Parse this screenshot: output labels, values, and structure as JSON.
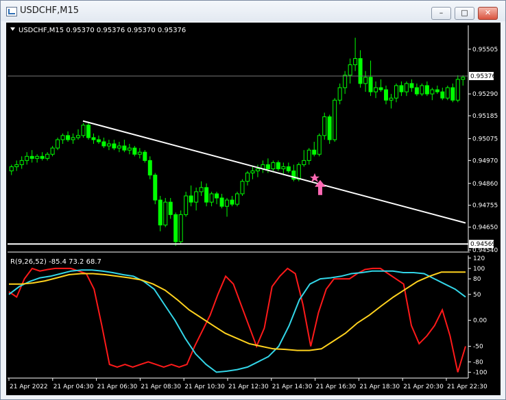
{
  "window": {
    "title": "USDCHF,M15",
    "buttons": {
      "minimize": "–",
      "maximize": "□",
      "close": "✕"
    }
  },
  "main_chart": {
    "header": "USDCHF,M15  0.95370 0.95376 0.95370 0.95376",
    "price_labels": [
      "0.95505",
      "0.95290",
      "0.95185",
      "0.95075",
      "0.94970",
      "0.94860",
      "0.94755",
      "0.94650",
      "0.94540"
    ],
    "current_price_label": "0.95376",
    "hline_price_label": "0.94569"
  },
  "indicator": {
    "header": "R(9,26,52) -85.4 73.2 68.7",
    "scale_labels": [
      "120",
      "100",
      "80",
      "50",
      "0.00",
      "-50",
      "-80",
      "-100"
    ]
  },
  "time_labels": [
    "21 Apr 2022",
    "21 Apr 04:30",
    "21 Apr 06:30",
    "21 Apr 08:30",
    "21 Apr 10:30",
    "21 Apr 12:30",
    "21 Apr 14:30",
    "21 Apr 16:30",
    "21 Apr 18:30",
    "21 Apr 20:30",
    "21 Apr 22:30"
  ],
  "colors": {
    "background": "#000000",
    "candles": "#00ff00",
    "trendline": "#ffffff",
    "arrow": "#ff69b4",
    "series_red": "#ff1a1a",
    "series_cyan": "#33d6e8",
    "series_yellow": "#ffd21e"
  },
  "chart_data": [
    {
      "type": "candlestick",
      "title": "USDCHF,M15",
      "ylim": [
        0.9454,
        0.9558
      ],
      "ohlc": [
        [
          0.9492,
          0.9495,
          0.949,
          0.9494
        ],
        [
          0.9494,
          0.9497,
          0.9492,
          0.9495
        ],
        [
          0.9495,
          0.9499,
          0.9493,
          0.9497
        ],
        [
          0.9497,
          0.9501,
          0.9495,
          0.9499
        ],
        [
          0.9499,
          0.9502,
          0.9496,
          0.9498
        ],
        [
          0.9498,
          0.95,
          0.9496,
          0.9499
        ],
        [
          0.9499,
          0.9501,
          0.9497,
          0.9498
        ],
        [
          0.9498,
          0.9501,
          0.9497,
          0.95
        ],
        [
          0.95,
          0.9504,
          0.9499,
          0.9503
        ],
        [
          0.9503,
          0.9508,
          0.9502,
          0.9507
        ],
        [
          0.9507,
          0.951,
          0.9505,
          0.9509
        ],
        [
          0.9509,
          0.9511,
          0.9506,
          0.9507
        ],
        [
          0.9507,
          0.951,
          0.9505,
          0.9508
        ],
        [
          0.9508,
          0.9512,
          0.9507,
          0.9509
        ],
        [
          0.9509,
          0.9515,
          0.9508,
          0.9514
        ],
        [
          0.9514,
          0.9515,
          0.9507,
          0.9508
        ],
        [
          0.9508,
          0.951,
          0.9505,
          0.9507
        ],
        [
          0.9507,
          0.9509,
          0.9505,
          0.9506
        ],
        [
          0.9506,
          0.9508,
          0.9503,
          0.9504
        ],
        [
          0.9504,
          0.9507,
          0.9502,
          0.9505
        ],
        [
          0.9505,
          0.9507,
          0.9502,
          0.9503
        ],
        [
          0.9503,
          0.9506,
          0.9501,
          0.9504
        ],
        [
          0.9504,
          0.9507,
          0.9501,
          0.9502
        ],
        [
          0.9502,
          0.9505,
          0.95,
          0.9503
        ],
        [
          0.9503,
          0.9504,
          0.9499,
          0.95
        ],
        [
          0.95,
          0.9503,
          0.9498,
          0.9501
        ],
        [
          0.9501,
          0.9502,
          0.9496,
          0.9497
        ],
        [
          0.9497,
          0.9499,
          0.9488,
          0.949
        ],
        [
          0.949,
          0.9491,
          0.9476,
          0.9478
        ],
        [
          0.9478,
          0.948,
          0.9463,
          0.9466
        ],
        [
          0.9466,
          0.9479,
          0.9465,
          0.9477
        ],
        [
          0.9477,
          0.9479,
          0.9469,
          0.9471
        ],
        [
          0.9471,
          0.9472,
          0.9456,
          0.9458
        ],
        [
          0.9458,
          0.9473,
          0.9457,
          0.9471
        ],
        [
          0.9471,
          0.9482,
          0.947,
          0.948
        ],
        [
          0.948,
          0.9485,
          0.9475,
          0.9477
        ],
        [
          0.9477,
          0.9484,
          0.9473,
          0.9482
        ],
        [
          0.9482,
          0.9487,
          0.948,
          0.9484
        ],
        [
          0.9484,
          0.9486,
          0.9475,
          0.9477
        ],
        [
          0.9477,
          0.9482,
          0.9475,
          0.9481
        ],
        [
          0.9481,
          0.9482,
          0.9476,
          0.9479
        ],
        [
          0.9479,
          0.9481,
          0.9474,
          0.9475
        ],
        [
          0.9475,
          0.9479,
          0.947,
          0.9478
        ],
        [
          0.9478,
          0.948,
          0.9475,
          0.9476
        ],
        [
          0.9476,
          0.9482,
          0.9475,
          0.9481
        ],
        [
          0.9481,
          0.9488,
          0.948,
          0.9487
        ],
        [
          0.9487,
          0.9492,
          0.9485,
          0.9491
        ],
        [
          0.9491,
          0.9494,
          0.9488,
          0.9492
        ],
        [
          0.9492,
          0.9495,
          0.9489,
          0.9493
        ],
        [
          0.9493,
          0.9497,
          0.9491,
          0.9495
        ],
        [
          0.9495,
          0.9498,
          0.9491,
          0.9493
        ],
        [
          0.9493,
          0.9497,
          0.9492,
          0.9496
        ],
        [
          0.9496,
          0.9497,
          0.9492,
          0.9493
        ],
        [
          0.9493,
          0.9496,
          0.949,
          0.9494
        ],
        [
          0.9494,
          0.9496,
          0.9491,
          0.9492
        ],
        [
          0.9492,
          0.9495,
          0.9487,
          0.9488
        ],
        [
          0.9488,
          0.9496,
          0.9487,
          0.9495
        ],
        [
          0.9495,
          0.9502,
          0.9494,
          0.9497
        ],
        [
          0.9497,
          0.9503,
          0.9495,
          0.9502
        ],
        [
          0.9502,
          0.9506,
          0.9499,
          0.95
        ],
        [
          0.95,
          0.951,
          0.9499,
          0.9509
        ],
        [
          0.9509,
          0.952,
          0.9507,
          0.9518
        ],
        [
          0.9518,
          0.9519,
          0.9505,
          0.9507
        ],
        [
          0.9507,
          0.9527,
          0.9506,
          0.9526
        ],
        [
          0.9526,
          0.9534,
          0.9524,
          0.9532
        ],
        [
          0.9532,
          0.954,
          0.9529,
          0.9538
        ],
        [
          0.9538,
          0.9546,
          0.9534,
          0.9543
        ],
        [
          0.9543,
          0.9556,
          0.954,
          0.9546
        ],
        [
          0.9546,
          0.955,
          0.9532,
          0.9534
        ],
        [
          0.9534,
          0.954,
          0.953,
          0.9537
        ],
        [
          0.9537,
          0.9545,
          0.9528,
          0.953
        ],
        [
          0.953,
          0.9535,
          0.9527,
          0.9532
        ],
        [
          0.9532,
          0.9536,
          0.953,
          0.9531
        ],
        [
          0.9531,
          0.9533,
          0.9524,
          0.9526
        ],
        [
          0.9526,
          0.9529,
          0.9522,
          0.9527
        ],
        [
          0.9527,
          0.9534,
          0.9525,
          0.9533
        ],
        [
          0.9533,
          0.9535,
          0.9528,
          0.953
        ],
        [
          0.953,
          0.9535,
          0.9528,
          0.9534
        ],
        [
          0.9534,
          0.9536,
          0.953,
          0.9532
        ],
        [
          0.9532,
          0.9534,
          0.9528,
          0.9529
        ],
        [
          0.9529,
          0.9534,
          0.9528,
          0.9533
        ],
        [
          0.9533,
          0.9535,
          0.9528,
          0.9529
        ],
        [
          0.9529,
          0.9532,
          0.9526,
          0.9531
        ],
        [
          0.9531,
          0.9533,
          0.9529,
          0.953
        ],
        [
          0.953,
          0.9532,
          0.9526,
          0.9527
        ],
        [
          0.9527,
          0.9533,
          0.9526,
          0.9532
        ],
        [
          0.9532,
          0.9534,
          0.9525,
          0.9526
        ],
        [
          0.9526,
          0.9538,
          0.9525,
          0.9536
        ],
        [
          0.9536,
          0.9538,
          0.9533,
          0.9537
        ]
      ],
      "trendline": {
        "start": [
          "21 Apr 04:30",
          0.9516
        ],
        "end": [
          "21 Apr 23:45",
          0.9467
        ]
      },
      "horizontal_line": 0.94569,
      "arrow_marker": {
        "time": "21 Apr 15:15",
        "price": 0.9487,
        "direction": "up"
      }
    },
    {
      "type": "line",
      "title": "R(9,26,52)",
      "ylim": [
        -110,
        125
      ],
      "series": [
        {
          "name": "",
          "values": [
            55,
            45,
            80,
            100,
            95,
            98,
            100,
            100,
            100,
            95,
            90,
            60,
            -10,
            -85,
            -90,
            -85,
            -90,
            -85,
            -80,
            -85,
            -90,
            -85,
            -90,
            -85,
            -50,
            -20,
            10,
            50,
            85,
            70,
            30,
            -10,
            -50,
            -15,
            65,
            85,
            100,
            90,
            30,
            -50,
            15,
            60,
            80,
            80,
            80,
            90,
            98,
            100,
            100,
            90,
            80,
            70,
            -10,
            -45,
            -30,
            -10,
            20,
            -30,
            -100,
            -50
          ]
        },
        {
          "name": "",
          "values": [
            50,
            65,
            75,
            82,
            85,
            90,
            95,
            97,
            97,
            95,
            92,
            88,
            85,
            75,
            60,
            30,
            0,
            -35,
            -65,
            -85,
            -100,
            -98,
            -95,
            -90,
            -80,
            -70,
            -50,
            -10,
            40,
            70,
            80,
            82,
            85,
            90,
            92,
            95,
            95,
            95,
            92,
            92,
            90,
            80,
            70,
            60,
            45
          ]
        },
        {
          "name": "",
          "values": [
            70,
            70,
            72,
            76,
            82,
            88,
            90,
            90,
            88,
            85,
            82,
            78,
            70,
            58,
            40,
            20,
            5,
            -10,
            -25,
            -35,
            -45,
            -50,
            -55,
            -56,
            -58,
            -58,
            -55,
            -40,
            -25,
            -5,
            10,
            28,
            45,
            60,
            75,
            85,
            93,
            93,
            93
          ]
        }
      ]
    }
  ]
}
